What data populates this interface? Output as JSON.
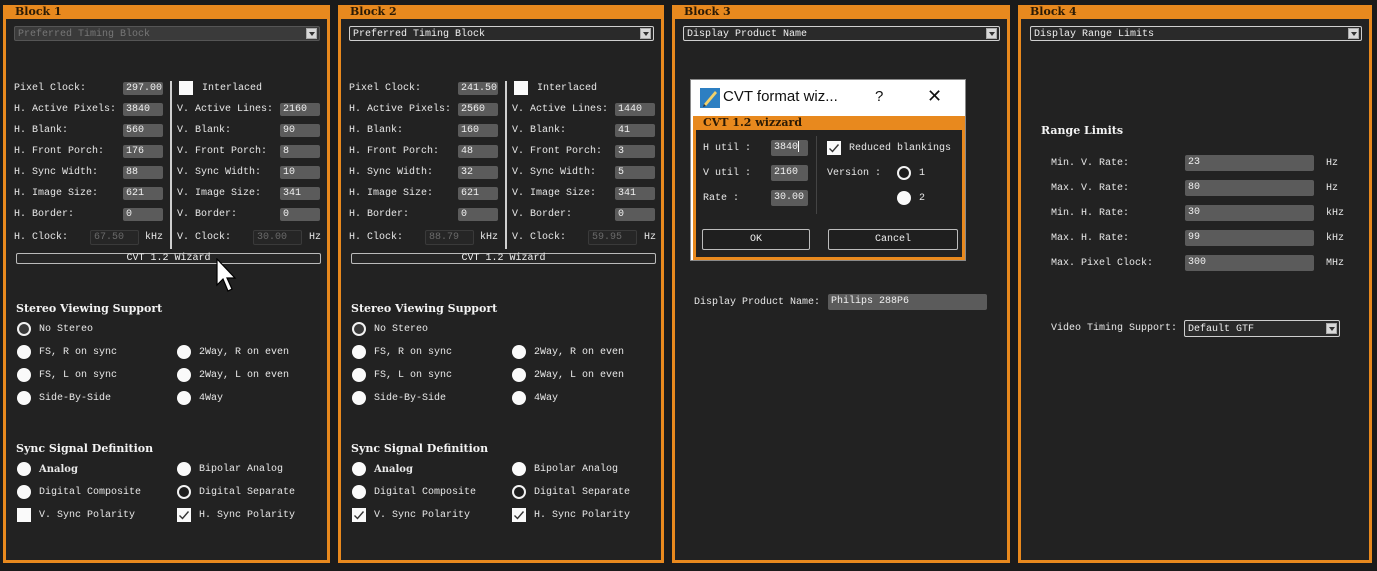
{
  "blocks": [
    {
      "title": "Block 1",
      "type_select": "Preferred Timing Block",
      "fields": {
        "pixel_clock": {
          "label": "Pixel Clock:",
          "value": "297.00"
        },
        "interlaced": {
          "label": "Interlaced",
          "checked": false
        },
        "h_active": {
          "label": "H. Active Pixels:",
          "value": "3840"
        },
        "v_active": {
          "label": "V. Active Lines:",
          "value": "2160"
        },
        "h_blank": {
          "label": "H. Blank:",
          "value": "560"
        },
        "v_blank": {
          "label": "V. Blank:",
          "value": "90"
        },
        "h_front": {
          "label": "H. Front Porch:",
          "value": "176"
        },
        "v_front": {
          "label": "V. Front Porch:",
          "value": "8"
        },
        "h_sync": {
          "label": "H. Sync Width:",
          "value": "88"
        },
        "v_sync": {
          "label": "V. Sync Width:",
          "value": "10"
        },
        "h_image": {
          "label": "H. Image Size:",
          "value": "621"
        },
        "v_image": {
          "label": "V. Image Size:",
          "value": "341"
        },
        "h_border": {
          "label": "H. Border:",
          "value": "0"
        },
        "v_border": {
          "label": "V. Border:",
          "value": "0"
        },
        "h_clock": {
          "label": "H. Clock:",
          "value": "67.50",
          "unit": "kHz"
        },
        "v_clock": {
          "label": "V. Clock:",
          "value": "30.00",
          "unit": "Hz"
        }
      },
      "wizard_button": "CVT 1.2 Wizard",
      "stereo": {
        "title": "Stereo Viewing Support",
        "options": [
          "No Stereo",
          "FS, R on sync",
          "2Way, R on even",
          "FS, L on sync",
          "2Way, L on even",
          "Side-By-Side",
          "4Way"
        ],
        "selected": "No Stereo"
      },
      "sync": {
        "title": "Sync Signal Definition",
        "analog": "Analog",
        "bipolar": "Bipolar Analog",
        "digital_composite": "Digital Composite",
        "digital_separate": "Digital Separate",
        "selected": "Digital Separate",
        "v_polarity": {
          "label": "V. Sync Polarity",
          "checked": false
        },
        "h_polarity": {
          "label": "H. Sync Polarity",
          "checked": true
        }
      }
    },
    {
      "title": "Block 2",
      "type_select": "Preferred Timing Block",
      "fields": {
        "pixel_clock": {
          "label": "Pixel Clock:",
          "value": "241.50"
        },
        "interlaced": {
          "label": "Interlaced",
          "checked": false
        },
        "h_active": {
          "label": "H. Active Pixels:",
          "value": "2560"
        },
        "v_active": {
          "label": "V. Active Lines:",
          "value": "1440"
        },
        "h_blank": {
          "label": "H. Blank:",
          "value": "160"
        },
        "v_blank": {
          "label": "V. Blank:",
          "value": "41"
        },
        "h_front": {
          "label": "H. Front Porch:",
          "value": "48"
        },
        "v_front": {
          "label": "V. Front Porch:",
          "value": "3"
        },
        "h_sync": {
          "label": "H. Sync Width:",
          "value": "32"
        },
        "v_sync": {
          "label": "V. Sync Width:",
          "value": "5"
        },
        "h_image": {
          "label": "H. Image Size:",
          "value": "621"
        },
        "v_image": {
          "label": "V. Image Size:",
          "value": "341"
        },
        "h_border": {
          "label": "H. Border:",
          "value": "0"
        },
        "v_border": {
          "label": "V. Border:",
          "value": "0"
        },
        "h_clock": {
          "label": "H. Clock:",
          "value": "88.79",
          "unit": "kHz"
        },
        "v_clock": {
          "label": "V. Clock:",
          "value": "59.95",
          "unit": "Hz"
        }
      },
      "wizard_button": "CVT 1.2 Wizard",
      "stereo": {
        "title": "Stereo Viewing Support",
        "options": [
          "No Stereo",
          "FS, R on sync",
          "2Way, R on even",
          "FS, L on sync",
          "2Way, L on even",
          "Side-By-Side",
          "4Way"
        ],
        "selected": "No Stereo"
      },
      "sync": {
        "title": "Sync Signal Definition",
        "analog": "Analog",
        "bipolar": "Bipolar Analog",
        "digital_composite": "Digital Composite",
        "digital_separate": "Digital Separate",
        "selected": "Digital Separate",
        "v_polarity": {
          "label": "V. Sync Polarity",
          "checked": true
        },
        "h_polarity": {
          "label": "H. Sync Polarity",
          "checked": true
        }
      }
    }
  ],
  "block3": {
    "title": "Block 3",
    "type_select": "Display Product Name",
    "product_name_label": "Display Product Name:",
    "product_name_value": "Philips 288P6"
  },
  "block4": {
    "title": "Block 4",
    "type_select": "Display Range Limits",
    "section_title": "Range Limits",
    "rows": [
      {
        "label": "Min. V. Rate:",
        "value": "23",
        "unit": "Hz"
      },
      {
        "label": "Max. V. Rate:",
        "value": "80",
        "unit": "Hz"
      },
      {
        "label": "Min. H. Rate:",
        "value": "30",
        "unit": "kHz"
      },
      {
        "label": "Max. H. Rate:",
        "value": "99",
        "unit": "kHz"
      },
      {
        "label": "Max. Pixel Clock:",
        "value": "300",
        "unit": "MHz"
      }
    ],
    "video_timing_label": "Video Timing Support:",
    "video_timing_value": "Default GTF"
  },
  "dialog": {
    "title": "CVT format wiz...",
    "help": "?",
    "close": "✕",
    "header": "CVT 1.2 wizzard",
    "h_util_label": "H util :",
    "h_util_value": "3840",
    "v_util_label": "V util :",
    "v_util_value": "2160",
    "rate_label": "Rate :",
    "rate_value": "30.00",
    "reduced_blankings_label": "Reduced blankings",
    "reduced_blankings_checked": true,
    "version_label": "Version :",
    "version_options": [
      "1",
      "2"
    ],
    "version_selected": "1",
    "ok_label": "OK",
    "cancel_label": "Cancel"
  }
}
